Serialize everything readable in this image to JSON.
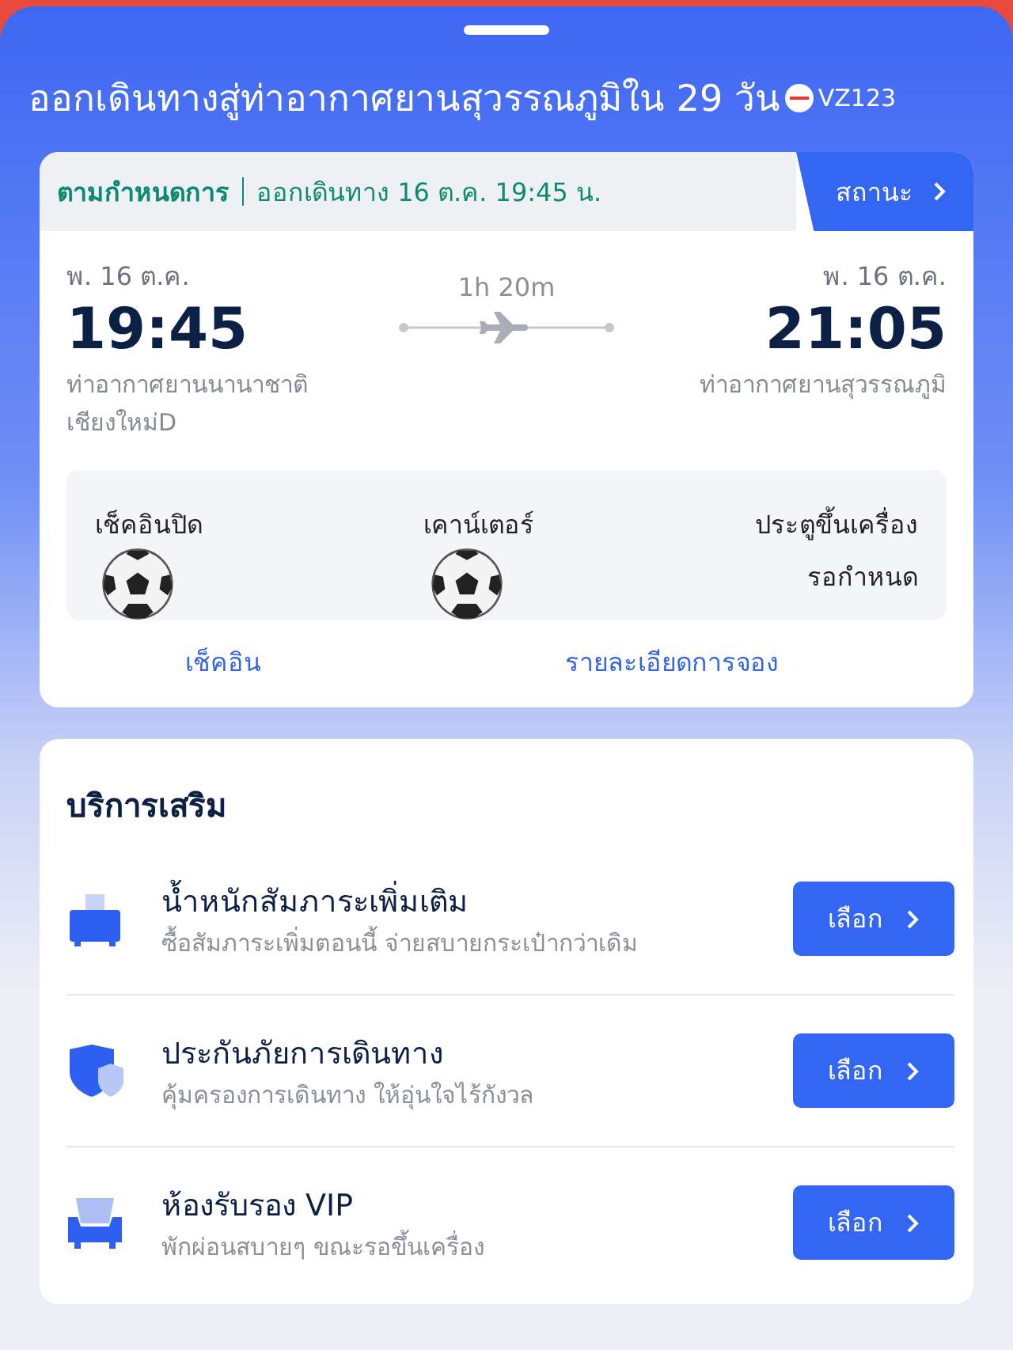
{
  "header": {
    "title": "ออกเดินทางสู่ท่าอากาศยานสุวรรณภูมิใน 29 วัน",
    "flight_number": "VZ123"
  },
  "status_strip": {
    "status": "ตามกำหนดการ",
    "departure": "ออกเดินทาง 16 ต.ค. 19:45 น.",
    "button": "สถานะ"
  },
  "flight": {
    "duration": "1h 20m",
    "departure": {
      "date": "พ. 16 ต.ค.",
      "time": "19:45",
      "airport": "ท่าอากาศยานนานาชาติเชียงใหม่D"
    },
    "arrival": {
      "date": "พ. 16 ต.ค.",
      "time": "21:05",
      "airport": "ท่าอากาศยานสุวรรณภูมิ"
    }
  },
  "info": [
    {
      "label": "เช็คอินปิด",
      "kind": "icon"
    },
    {
      "label": "เคาน์เตอร์",
      "kind": "icon"
    },
    {
      "label": "ประตูขึ้นเครื่อง",
      "kind": "text",
      "value": "รอกำหนด"
    }
  ],
  "links": [
    "เช็คอิน",
    "รายละเอียดการจอง"
  ],
  "services": {
    "title": "บริการเสริม",
    "items": [
      {
        "kind": "luggage",
        "title": "น้ำหนักสัมภาระเพิ่มเติม",
        "subtitle": "ซื้อสัมภาระเพิ่มตอนนี้ จ่ายสบายกระเป๋ากว่าเดิม",
        "button": "เลือก"
      },
      {
        "kind": "insurance",
        "title": "ประกันภัยการเดินทาง",
        "subtitle": "คุ้มครองการเดินทาง ให้อุ่นใจไร้กังวล",
        "button": "เลือก"
      },
      {
        "kind": "lounge",
        "title": "ห้องรับรอง VIP",
        "subtitle": "พักผ่อนสบายๆ ขณะรอขึ้นเครื่อง",
        "button": "เลือก"
      }
    ]
  }
}
